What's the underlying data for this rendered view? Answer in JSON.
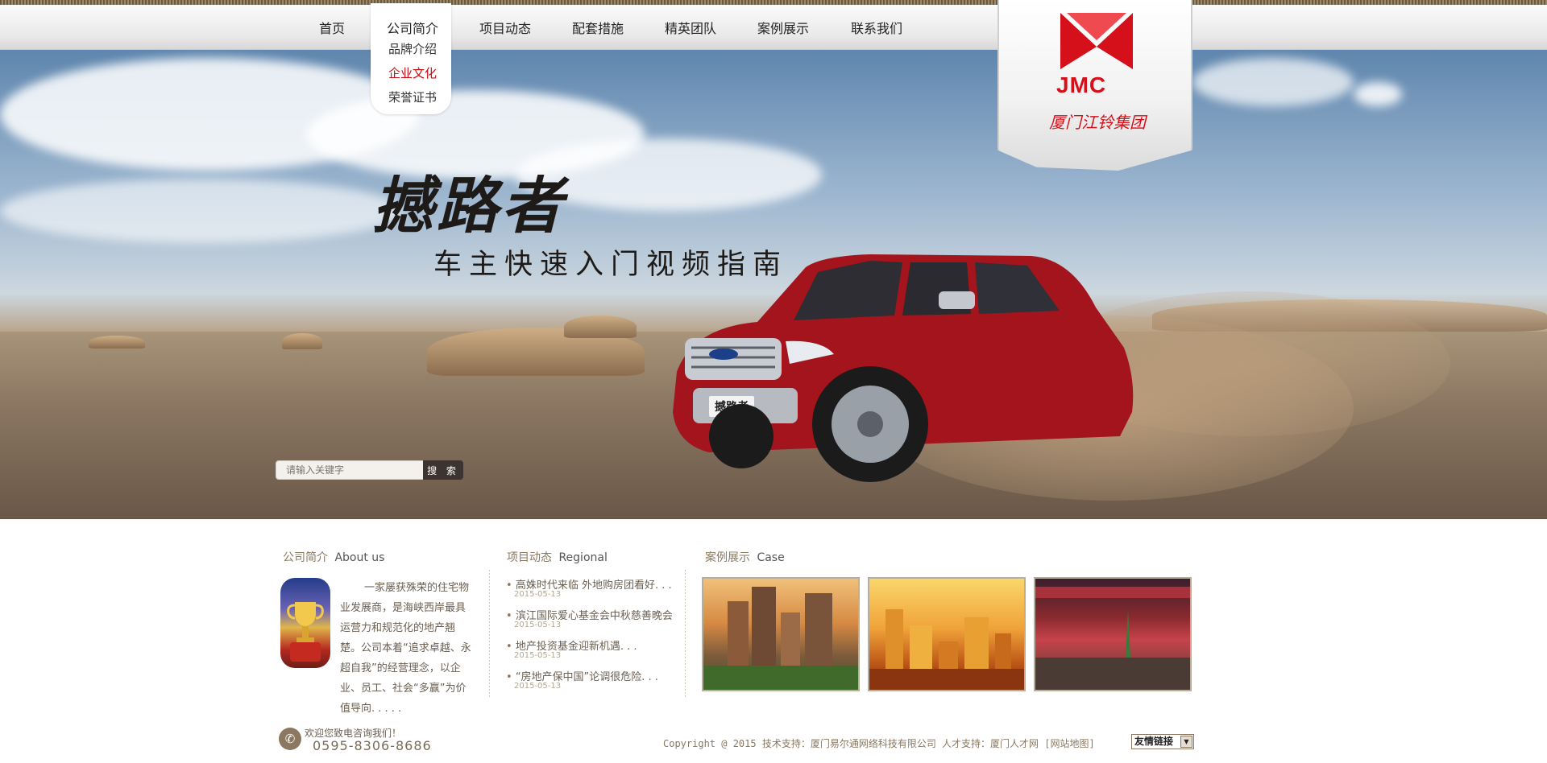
{
  "nav": {
    "items": [
      {
        "label": "首页"
      },
      {
        "label": "公司简介"
      },
      {
        "label": "项目动态"
      },
      {
        "label": "配套措施"
      },
      {
        "label": "精英团队"
      },
      {
        "label": "案例展示"
      },
      {
        "label": "联系我们"
      }
    ],
    "dropdown": {
      "title": "公司简介",
      "items": [
        {
          "label": "品牌介绍"
        },
        {
          "label": "企业文化"
        },
        {
          "label": "荣誉证书"
        }
      ]
    }
  },
  "logo": {
    "mark_text": "JMC",
    "company_cn": "厦门江铃集团",
    "color": "#d6101a"
  },
  "hero": {
    "title": "撼路者",
    "subtitle": "车主快速入门视频指南",
    "plate": "撼路者"
  },
  "search": {
    "placeholder": "请输入关键字",
    "button_label": "搜 索"
  },
  "about": {
    "title_cn": "公司简介",
    "title_en": "About us",
    "text": "一家屡获殊荣的住宅物业发展商，是海峡西岸最具运营力和规范化的地产翘楚。公司本着“追求卓越、永超自我”的经营理念，以企业、员工、社会“多赢”为价值导向. . . . ."
  },
  "news": {
    "title_cn": "项目动态",
    "title_en": "Regional",
    "items": [
      {
        "title": "高姝时代来临  外地购房团看好. . .",
        "date": "2015-05-13"
      },
      {
        "title": "滨江国际爱心基金会中秋慈善晚会",
        "date": "2015-05-13"
      },
      {
        "title": "地产投资基金迎新机遇. . .",
        "date": "2015-05-13"
      },
      {
        "title": "“房地产保中国”论调很危险. . .",
        "date": "2015-05-13"
      }
    ]
  },
  "cases": {
    "title_cn": "案例展示",
    "title_en": "Case"
  },
  "footer": {
    "welcome": "欢迎您致电咨询我们！",
    "phone": "0595-8306-8686",
    "copyright": "Copyright @ 2015 技术支持：厦门易尔通网络科技有限公司  人才支持：厦门人才网 [网站地图]",
    "links_select": "友情链接"
  }
}
